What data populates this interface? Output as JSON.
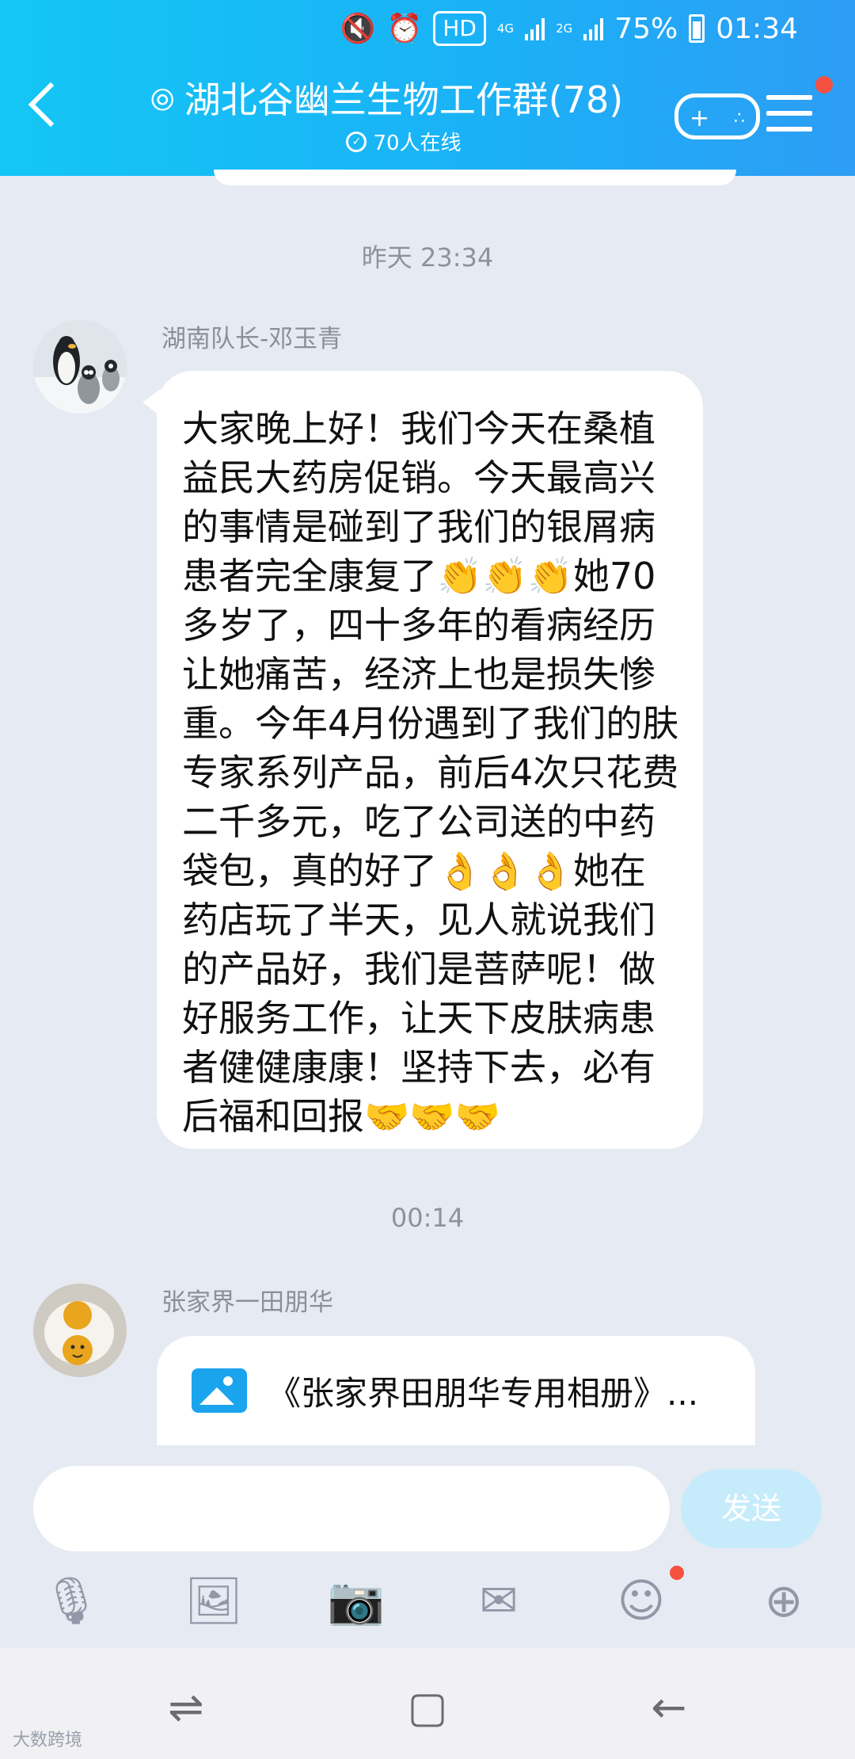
{
  "status_bar": {
    "hd": "HD",
    "net_4g": "4G",
    "net_2g": "2G",
    "battery": "75%",
    "time": "01:34"
  },
  "header": {
    "title": "湖北谷幽兰生物工作群(78)",
    "online": "70人在线",
    "online_icon": "✓"
  },
  "messages": [
    {
      "timestamp": "昨天 23:34",
      "sender": "湖南队长-邓玉青",
      "text": "大家晚上好！我们今天在桑植益民大药房促销。今天最高兴的事情是碰到了我们的银屑病患者完全康复了👏👏👏她70多岁了，四十多年的看病经历让她痛苦，经济上也是损失惨重。今年4月份遇到了我们的肤专家系列产品，前后4次只花费二千多元，吃了公司送的中药袋包，真的好了👌👌👌她在药店玩了半天，见人就说我们的产品好，我们是菩萨呢！做好服务工作，让天下皮肤病患者健健康康！坚持下去，必有后福和回报🤝🤝🤝"
    },
    {
      "timestamp": "00:14",
      "sender": "张家界一田朋华",
      "file_name": "《张家界田朋华专用相册》..."
    }
  ],
  "input": {
    "placeholder": "",
    "send_label": "发送"
  },
  "toolbar": [
    "mic-icon",
    "image-icon",
    "camera-icon",
    "red-packet-icon",
    "emoji-icon",
    "plus-icon"
  ],
  "watermark": "大数跨境",
  "colors": {
    "header_start": "#14c6f5",
    "header_end": "#2d9df5",
    "chat_bg": "#e6eaf2",
    "badge": "#f55140"
  }
}
